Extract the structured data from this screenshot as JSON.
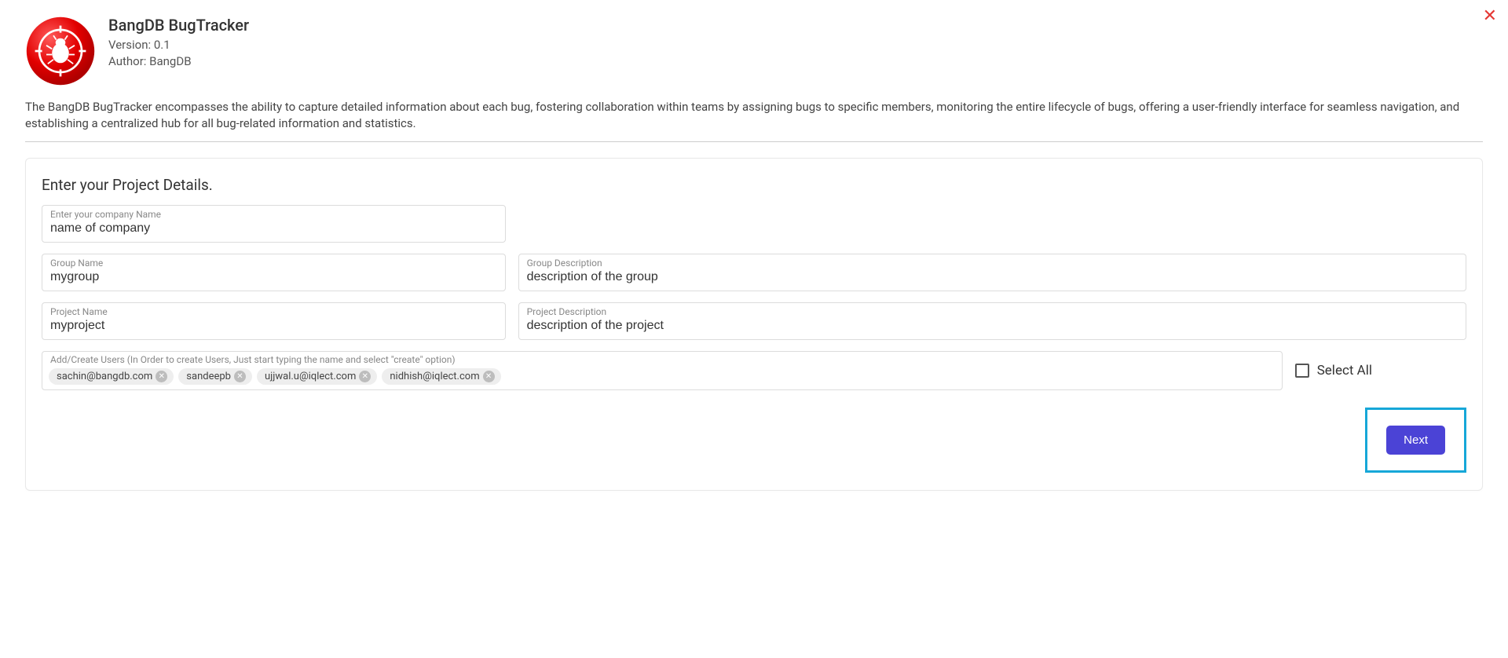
{
  "header": {
    "title": "BangDB BugTracker",
    "version_prefix": "Version: ",
    "version": "0.1",
    "author_prefix": "Author: ",
    "author": "BangDB"
  },
  "description": "The BangDB BugTracker encompasses the ability to capture detailed information about each bug, fostering collaboration within teams by assigning bugs to specific members, monitoring the entire lifecycle of bugs, offering a user-friendly interface for seamless navigation, and establishing a centralized hub for all bug-related information and statistics.",
  "card": {
    "title": "Enter your Project Details.",
    "company": {
      "label": "Enter your company Name",
      "value": "name of company"
    },
    "group_name": {
      "label": "Group Name",
      "value": "mygroup"
    },
    "group_desc": {
      "label": "Group Description",
      "value": "description of the group"
    },
    "project_name": {
      "label": "Project Name",
      "value": "myproject"
    },
    "project_desc": {
      "label": "Project Description",
      "value": "description of the project"
    },
    "users_label": "Add/Create Users (In Order to create Users, Just start typing the name and select \"create\" option)",
    "users": [
      "sachin@bangdb.com",
      "sandeepb",
      "ujjwal.u@iqlect.com",
      "nidhish@iqlect.com"
    ],
    "select_all_label": "Select All",
    "next_label": "Next"
  }
}
